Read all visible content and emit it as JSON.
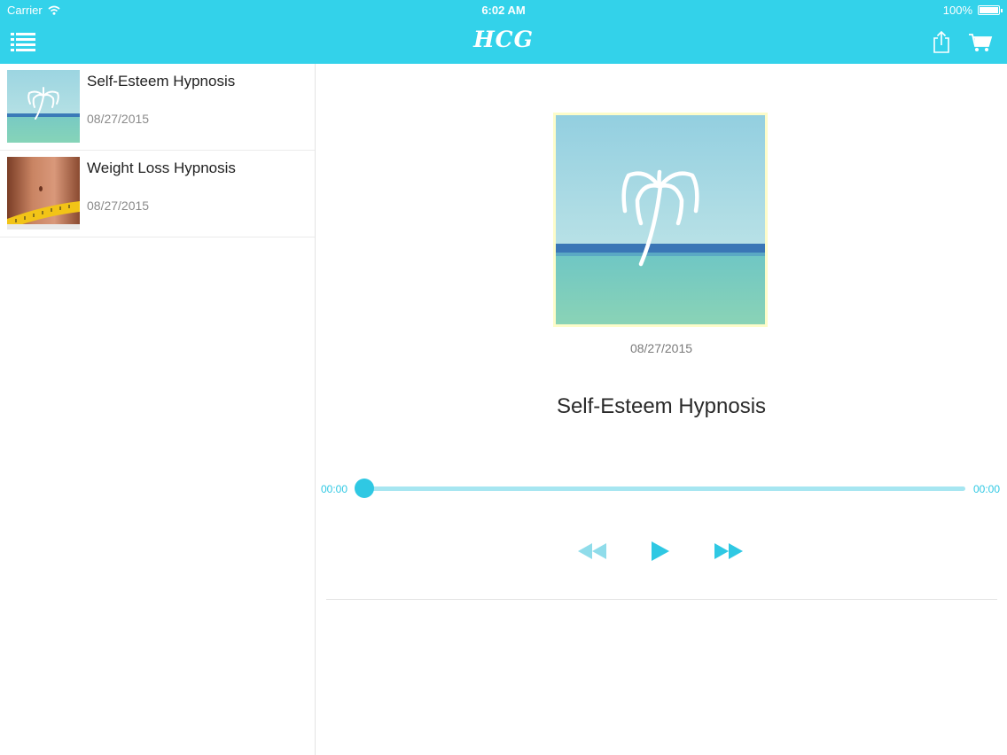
{
  "status_bar": {
    "carrier": "Carrier",
    "time": "6:02 AM",
    "battery": "100%",
    "icons": [
      "wifi-icon",
      "battery-icon"
    ]
  },
  "nav": {
    "title": "HCG",
    "icons": [
      "menu-list-icon",
      "share-icon",
      "cart-icon"
    ]
  },
  "colors": {
    "accent": "#33d2ea",
    "progress": "#2fc8e3",
    "track": "#a6e6f1",
    "artwork_border": "#fdfcc9"
  },
  "playlist": [
    {
      "title": "Self-Esteem Hypnosis",
      "date": "08/27/2015",
      "thumb": "palm-beach-thumbnail"
    },
    {
      "title": "Weight Loss Hypnosis",
      "date": "08/27/2015",
      "thumb": "measuring-tape-waist-thumbnail"
    }
  ],
  "player": {
    "artwork": "palm-beach-artwork",
    "date": "08/27/2015",
    "title": "Self-Esteem Hypnosis",
    "time_elapsed": "00:00",
    "time_total": "00:00",
    "progress": 0,
    "controls": [
      "rewind-icon",
      "play-icon",
      "fast-forward-icon"
    ]
  }
}
